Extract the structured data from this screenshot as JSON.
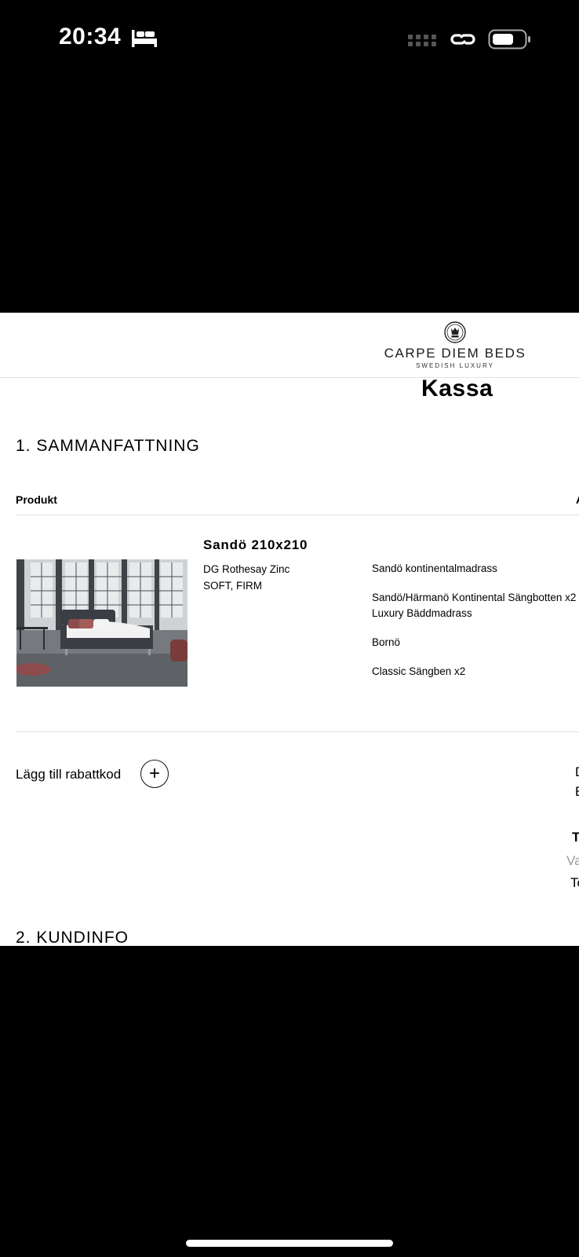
{
  "status_bar": {
    "time": "20:34",
    "icons": [
      "bed-icon",
      "cellular-signal-icon",
      "link-icon",
      "battery-icon"
    ]
  },
  "header": {
    "logo_name": "CARPE DIEM BEDS",
    "logo_tagline": "SWEDISH LUXURY"
  },
  "page": {
    "title": "Kassa"
  },
  "summary": {
    "section_title": "1. SAMMANFATTNING",
    "column_header": "Produkt",
    "column_header_right": "A",
    "product": {
      "name": "Sandö 210x210",
      "variant_fabric": "DG Rothesay Zinc",
      "variant_firmness": "SOFT, FIRM",
      "components": [
        "Sandö kontinentalmadrass",
        "Sandö/Härmanö Kontinental Sängbotten x2",
        "Luxury Bäddmadrass",
        "Bornö",
        "Classic Sängben x2"
      ]
    },
    "discount_label": "Lägg till rabattkod",
    "add_icon": "plus-icon",
    "right_edge": [
      "D",
      "E",
      "T",
      "Va",
      "To"
    ]
  },
  "customer": {
    "section_title": "2. KUNDINFO"
  },
  "colors": {
    "background": "#000000",
    "page": "#ffffff",
    "divider": "#e0e0e0",
    "muted_text": "#999999"
  }
}
